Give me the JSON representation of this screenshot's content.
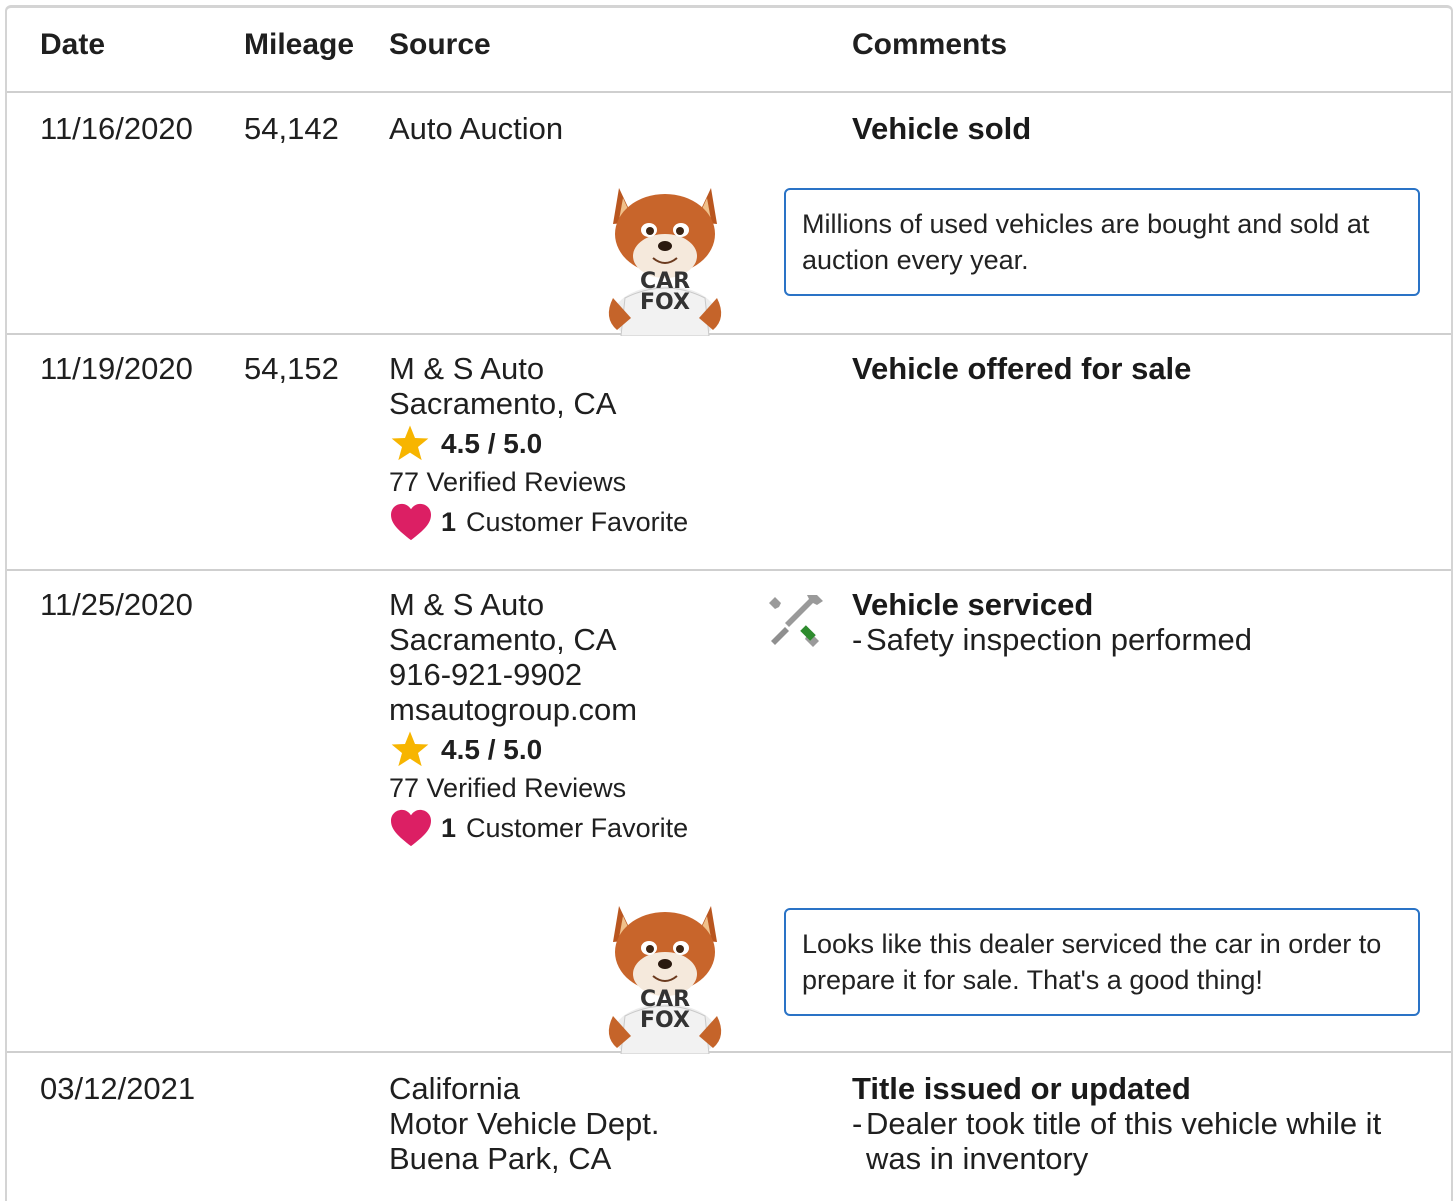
{
  "header": {
    "date": "Date",
    "mileage": "Mileage",
    "source": "Source",
    "comments": "Comments"
  },
  "rows": [
    {
      "date": "11/16/2020",
      "mileage": "54,142",
      "source": [
        "Auto Auction"
      ],
      "comment_title": "Vehicle sold",
      "tip": "Millions of used vehicles are bought and sold at auction every year.",
      "mascot_text": [
        "CAR",
        "FOX"
      ]
    },
    {
      "date": "11/19/2020",
      "mileage": "54,152",
      "source": [
        "M & S Auto",
        "Sacramento, CA"
      ],
      "rating": "4.5 / 5.0",
      "reviews": "77 Verified Reviews",
      "favorite_count": "1",
      "favorite_label": "Customer Favorite",
      "comment_title": "Vehicle offered for sale"
    },
    {
      "date": "11/25/2020",
      "mileage": "",
      "source": [
        "M & S Auto",
        "Sacramento, CA",
        "916-921-9902",
        "msautogroup.com"
      ],
      "rating": "4.5 / 5.0",
      "reviews": "77 Verified Reviews",
      "favorite_count": "1",
      "favorite_label": "Customer Favorite",
      "comment_title": "Vehicle serviced",
      "comment_items": [
        "Safety inspection performed"
      ],
      "tip": "Looks like this dealer serviced the car in order to prepare it for sale. That's a good thing!",
      "icon": "tools-icon",
      "mascot_text": [
        "CAR",
        "FOX"
      ]
    },
    {
      "date": "03/12/2021",
      "mileage": "",
      "source": [
        "California",
        "Motor Vehicle Dept.",
        "Buena Park, CA"
      ],
      "comment_title": "Title issued or updated",
      "comment_items": [
        "Dealer took title of this vehicle while it was in inventory"
      ]
    }
  ],
  "colors": {
    "star": "#f7b500",
    "heart": "#dc1f64",
    "tip_border": "#2a73c6",
    "divider": "#cfcfcf",
    "tool_handle": "#2e8b2e"
  }
}
